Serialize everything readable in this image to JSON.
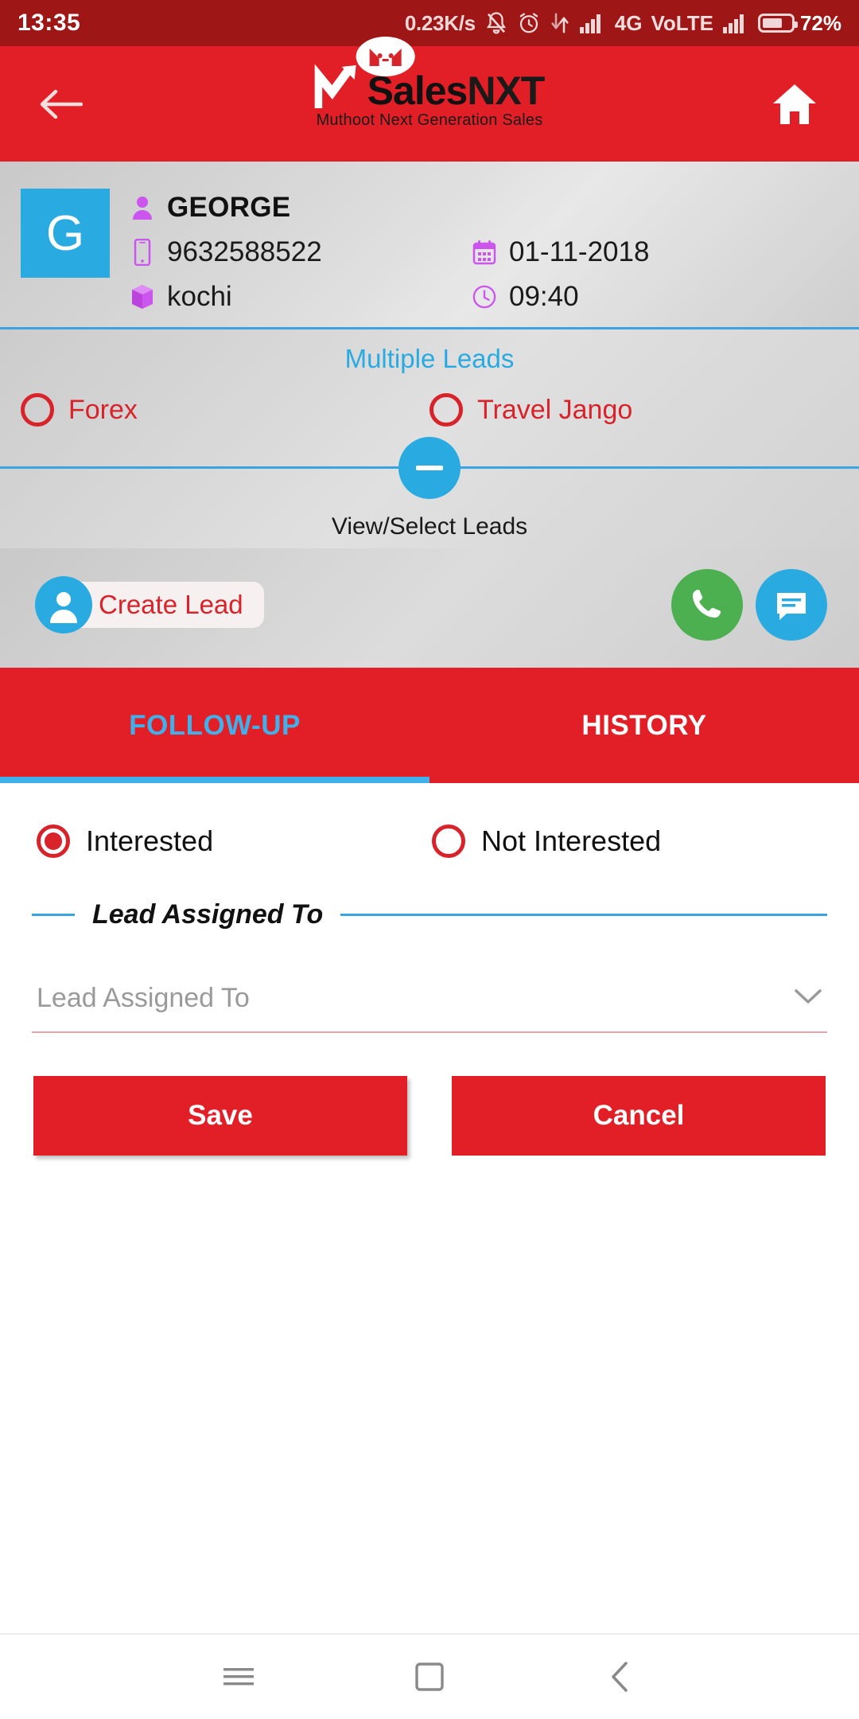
{
  "status_bar": {
    "time": "13:35",
    "net_speed": "0.23K/s",
    "network_type": "4G",
    "volte": "VoLTE",
    "battery_percent": "72%",
    "icons": [
      "mute-bell-icon",
      "alarm-clock-icon",
      "data-transfer-icon",
      "signal-bars-icon",
      "signal-bars-icon-2",
      "battery-icon"
    ]
  },
  "app_bar": {
    "back_icon": "back-arrow-icon",
    "logo_sales": "Sales",
    "logo_nxt": "NXT",
    "logo_tagline": "Muthoot Next Generation Sales",
    "home_icon": "home-icon"
  },
  "contact": {
    "avatar_letter": "G",
    "name": "GEORGE",
    "phone": "9632588522",
    "date": "01-11-2018",
    "location": "kochi",
    "time": "09:40",
    "icons": {
      "person": "person-icon",
      "phone": "mobile-phone-icon",
      "calendar": "calendar-icon",
      "product": "box-icon",
      "clock": "clock-icon"
    }
  },
  "leads": {
    "title": "Multiple Leads",
    "options": [
      {
        "label": "Forex",
        "selected": false
      },
      {
        "label": "Travel Jango",
        "selected": false
      }
    ],
    "toggle_icon": "minus-circle-icon",
    "view_select_label": "View/Select Leads"
  },
  "actions": {
    "create_lead_label": "Create Lead",
    "create_lead_icon": "person-add-icon",
    "call_icon": "phone-call-icon",
    "sms_icon": "message-icon"
  },
  "tabs": [
    {
      "label": "FOLLOW-UP",
      "active": true
    },
    {
      "label": "HISTORY",
      "active": false
    }
  ],
  "follow_up": {
    "status_options": [
      {
        "label": "Interested",
        "selected": true
      },
      {
        "label": "Not Interested",
        "selected": false
      }
    ],
    "section_title": "Lead Assigned To",
    "assignee_placeholder": "Lead Assigned To",
    "assignee_value": "",
    "dropdown_icon": "chevron-down-icon",
    "save_label": "Save",
    "cancel_label": "Cancel"
  },
  "nav_bar": {
    "menu_icon": "menu-icon",
    "home_icon": "square-home-icon",
    "back_icon": "chevron-back-icon"
  },
  "colors": {
    "brand_red": "#e21f26",
    "status_red": "#9e1616",
    "accent_blue": "#29abe2",
    "lead_red": "#d8232a",
    "green": "#4caf50"
  }
}
